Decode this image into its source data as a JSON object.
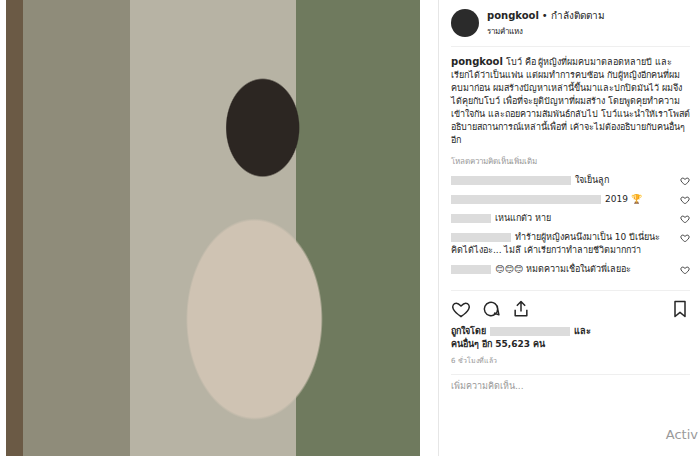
{
  "post": {
    "username": "pongkool",
    "separator": "•",
    "follow_status": "กำลังติดตาม",
    "location": "รามคำแหง"
  },
  "caption": {
    "username": "pongkool",
    "text": "โบว์ คือ ผู้หญิงที่ผมคบมาตลอดหลายปี และเรียกได้ว่าเป็นแฟน แต่ผมทำการคบซ้อน กับผู้หญิงอีกคนที่ผมคบมาก่อน ผมสร้างปัญหาเหล่านี้ขึ้นมาและปกปิดมันไว้ ผมจึงได้คุยกับโบว์ เพื่อที่จะยุติปัญหาที่ผมสร้าง โดยพูดคุยทำความเข้าใจกัน และถอยความสัมพันธ์กลับไป โบว์แนะนำให้เราโพสต์อธิบายสถานการณ์เหล่านี้เพื่อที่ เค้าจะไม่ต้องอธิบายกับคนอื่นๆอีก"
  },
  "load_more": "โหลดความคิดเห็นเพิ่มเติม",
  "comments": [
    {
      "text": "ใจเย็นลูก"
    },
    {
      "text": "2019 🏆"
    },
    {
      "text": "เหนแกตัว หาย"
    },
    {
      "text": "ทำร้ายผู้หญิงคนนึงมาเป็น 10 ปีเนี่ยนะ คิดได้ไงอะ... ไม่ลึ เค้าเรียกว่าทำลายชีวิตมากกว่า"
    },
    {
      "text": "😊😊😊 หมดความเชื่อในตัวพี่เลยอะ"
    }
  ],
  "likes": {
    "prefix": "ถูกใจโดย",
    "joiner": "และ",
    "rest": "คนอื่นๆ อีก 55,623 คน"
  },
  "time": "6 ชั่วโมงที่แล้ว",
  "add_comment": "เพิ่มความคิดเห็น...",
  "watermark": "Activ"
}
